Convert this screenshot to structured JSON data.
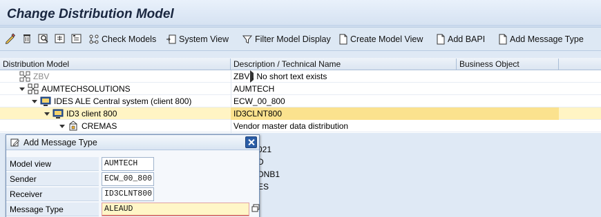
{
  "header": {
    "title": "Change Distribution Model"
  },
  "toolbar": {
    "check_models": "Check Models",
    "system_view": "System View",
    "filter_model_display": "Filter Model Display",
    "create_model_view": "Create Model View",
    "add_bapi": "Add BAPI",
    "add_message_type": "Add Message Type"
  },
  "tree": {
    "columns": [
      "Distribution Model",
      "Description / Technical Name",
      "Business Object"
    ],
    "rows": [
      {
        "name": "ZBV",
        "desc": "ZBV       . No short text exists"
      },
      {
        "name": "AUMTECHSOLUTIONS",
        "desc": "AUMTECH"
      },
      {
        "name": "IDES ALE Central system (client 800)",
        "desc": "ECW_00_800"
      },
      {
        "name": "ID3 client 800",
        "desc": "ID3CLNT800"
      },
      {
        "name": "CREMAS",
        "desc": "Vendor master data distribution"
      }
    ],
    "background_partial": [
      "021",
      "D",
      "DNB1",
      "ES"
    ]
  },
  "dialog": {
    "title": "Add Message Type",
    "fields": [
      {
        "label": "Model view",
        "value": "AUMTECH"
      },
      {
        "label": "Sender",
        "value": "ECW_00_800"
      },
      {
        "label": "Receiver",
        "value": "ID3CLNT800"
      },
      {
        "label": "Message Type",
        "value": "ALEAUD"
      }
    ]
  },
  "colors": {
    "selected_row": "#fbe28e",
    "title_text": "#1a2740",
    "close_button": "#2b5ea6"
  }
}
